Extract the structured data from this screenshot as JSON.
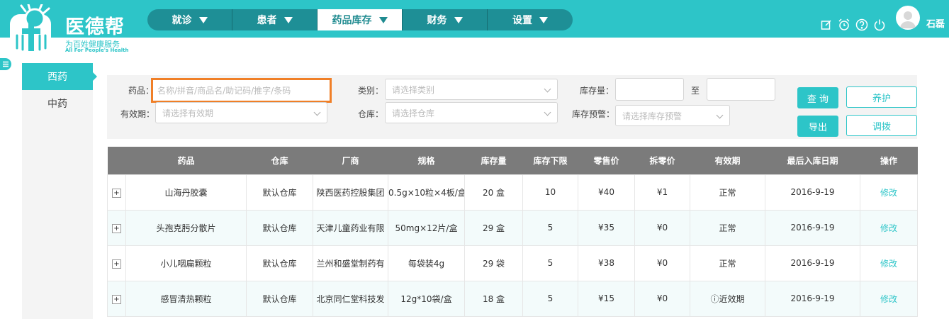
{
  "brand": {
    "name": "医德帮",
    "slogan": "为百姓健康服务",
    "slogan_en": "All For People's Health"
  },
  "nav": [
    {
      "label": "就诊",
      "active": false
    },
    {
      "label": "患者",
      "active": false
    },
    {
      "label": "药品库存",
      "active": true
    },
    {
      "label": "财务",
      "active": false
    },
    {
      "label": "设置",
      "active": false
    }
  ],
  "header_icons": [
    "edit-icon",
    "alarm-clock-icon",
    "help-icon",
    "power-icon"
  ],
  "user": {
    "name": "石磊"
  },
  "sidebar": {
    "items": [
      {
        "label": "西药",
        "active": true
      },
      {
        "label": "中药",
        "active": false
      }
    ]
  },
  "filters": {
    "drug_label": "药品：",
    "drug_placeholder": "名称/拼音/商品名/助记码/推字/条码",
    "category_label": "类别：",
    "category_placeholder": "请选择类别",
    "stock_label": "库存量：",
    "stock_to": "至",
    "validity_label": "有效期：",
    "validity_placeholder": "请选择有效期",
    "warehouse_label": "仓库：",
    "warehouse_placeholder": "请选择仓库",
    "stock_warning_label": "库存预警：",
    "stock_warning_placeholder": "请选择库存预警"
  },
  "buttons": {
    "query": "查 询",
    "maintain": "养护",
    "export": "导出",
    "transfer": "调拨"
  },
  "table": {
    "headers": [
      "",
      "药品",
      "仓库",
      "厂商",
      "规格",
      "库存量",
      "库存下限",
      "零售价",
      "拆零价",
      "有效期",
      "最后入库日期",
      "操作"
    ],
    "rows": [
      {
        "expand": "+",
        "drug": "山海丹胶囊",
        "warehouse": "默认仓库",
        "maker": "陕西医药控股集团",
        "spec": "0.5g×10粒×4板/盒",
        "stock": "20 盒",
        "min": "10",
        "retail": "¥40",
        "split": "¥1",
        "validity": "正常",
        "last_in": "2016-9-19",
        "action": "修改",
        "warn": false
      },
      {
        "expand": "+",
        "drug": "头孢克肟分散片",
        "warehouse": "默认仓库",
        "maker": "天津儿童药业有限",
        "spec": "50mg×12片/盒",
        "stock": "29 盒",
        "min": "5",
        "retail": "¥35",
        "split": "¥0",
        "validity": "正常",
        "last_in": "2016-9-19",
        "action": "修改",
        "warn": false
      },
      {
        "expand": "+",
        "drug": "小儿咽扁颗粒",
        "warehouse": "默认仓库",
        "maker": "兰州和盛堂制药有",
        "spec": "每袋装4g",
        "stock": "29 袋",
        "min": "5",
        "retail": "¥38",
        "split": "¥0",
        "validity": "正常",
        "last_in": "2016-9-19",
        "action": "修改",
        "warn": false
      },
      {
        "expand": "+",
        "drug": "感冒清热颗粒",
        "warehouse": "默认仓库",
        "maker": "北京同仁堂科技发",
        "spec": "12g*10袋/盒",
        "stock": "18 盒",
        "min": "5",
        "retail": "¥15",
        "split": "¥0",
        "validity": "ⓘ近效期",
        "last_in": "2016-9-19",
        "action": "修改",
        "warn": true
      }
    ]
  },
  "colors": {
    "primary": "#2dc5c8",
    "nav_bg": "#1e8f96",
    "table_header": "#7b7b7b",
    "highlight_border": "#f07f27"
  }
}
